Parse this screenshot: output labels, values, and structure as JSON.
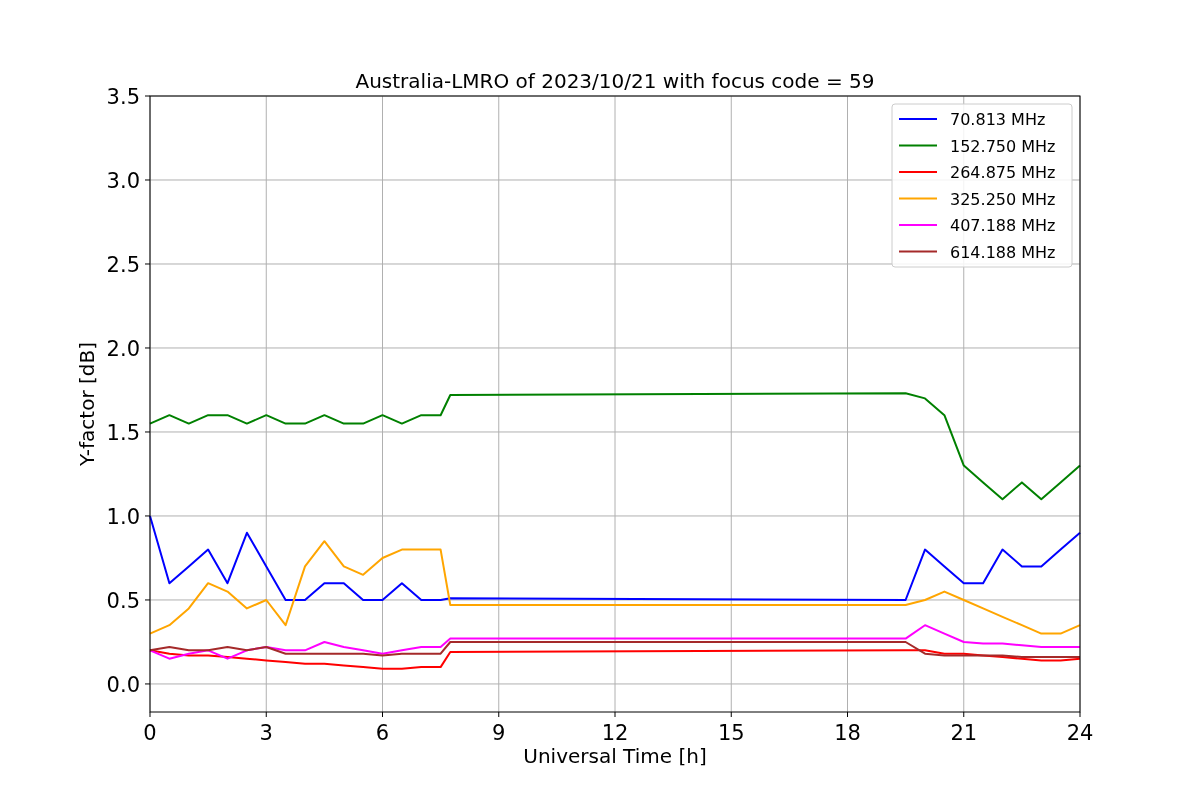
{
  "chart_data": {
    "type": "line",
    "title": "Australia-LMRO of 2023/10/21 with focus code = 59",
    "xlabel": "Universal Time [h]",
    "ylabel": "Y-factor [dB]",
    "x": [
      0,
      0.5,
      1,
      1.5,
      2,
      2.5,
      3,
      3.5,
      4,
      4.5,
      5,
      5.5,
      6,
      6.5,
      7,
      7.5,
      7.75,
      19.5,
      20,
      20.5,
      21,
      21.5,
      22,
      22.5,
      23,
      23.5,
      24
    ],
    "series": [
      {
        "name": "70.813 MHz",
        "color": "#0000ff",
        "values": [
          1.0,
          0.6,
          0.7,
          0.8,
          0.6,
          0.9,
          0.7,
          0.5,
          0.5,
          0.6,
          0.6,
          0.5,
          0.5,
          0.6,
          0.5,
          0.5,
          0.51,
          0.5,
          0.8,
          0.7,
          0.6,
          0.6,
          0.8,
          0.7,
          0.7,
          0.8,
          0.9
        ]
      },
      {
        "name": "152.750 MHz",
        "color": "#008000",
        "values": [
          1.55,
          1.6,
          1.55,
          1.6,
          1.6,
          1.55,
          1.6,
          1.55,
          1.55,
          1.6,
          1.55,
          1.55,
          1.6,
          1.55,
          1.6,
          1.6,
          1.72,
          1.73,
          1.7,
          1.6,
          1.3,
          1.2,
          1.1,
          1.2,
          1.1,
          1.2,
          1.3
        ]
      },
      {
        "name": "264.875 MHz",
        "color": "#ff0000",
        "values": [
          0.2,
          0.18,
          0.17,
          0.17,
          0.16,
          0.15,
          0.14,
          0.13,
          0.12,
          0.12,
          0.11,
          0.1,
          0.09,
          0.09,
          0.1,
          0.1,
          0.19,
          0.2,
          0.2,
          0.18,
          0.18,
          0.17,
          0.16,
          0.15,
          0.14,
          0.14,
          0.15
        ]
      },
      {
        "name": "325.250 MHz",
        "color": "#ffa500",
        "values": [
          0.3,
          0.35,
          0.45,
          0.6,
          0.55,
          0.45,
          0.5,
          0.35,
          0.7,
          0.85,
          0.7,
          0.65,
          0.75,
          0.8,
          0.8,
          0.8,
          0.47,
          0.47,
          0.5,
          0.55,
          0.5,
          0.45,
          0.4,
          0.35,
          0.3,
          0.3,
          0.35
        ]
      },
      {
        "name": "407.188 MHz",
        "color": "#ff00ff",
        "values": [
          0.2,
          0.15,
          0.18,
          0.2,
          0.15,
          0.2,
          0.22,
          0.2,
          0.2,
          0.25,
          0.22,
          0.2,
          0.18,
          0.2,
          0.22,
          0.22,
          0.27,
          0.27,
          0.35,
          0.3,
          0.25,
          0.24,
          0.24,
          0.23,
          0.22,
          0.22,
          0.22
        ]
      },
      {
        "name": "614.188 MHz",
        "color": "#a52a2a",
        "values": [
          0.2,
          0.22,
          0.2,
          0.2,
          0.22,
          0.2,
          0.22,
          0.18,
          0.18,
          0.18,
          0.18,
          0.18,
          0.17,
          0.18,
          0.18,
          0.18,
          0.25,
          0.25,
          0.18,
          0.17,
          0.17,
          0.17,
          0.17,
          0.16,
          0.16,
          0.16,
          0.16
        ]
      }
    ],
    "grid": true,
    "legend": true,
    "xlim": [
      0,
      24
    ],
    "ylim": [
      -0.167,
      3.5
    ],
    "xticks": [
      0,
      3,
      6,
      9,
      12,
      15,
      18,
      21,
      24
    ],
    "yticks": [
      {
        "value": 0,
        "label": "0.0"
      },
      {
        "value": 0.5,
        "label": "0.5"
      },
      {
        "value": 1,
        "label": "1.0"
      },
      {
        "value": 1.5,
        "label": "1.5"
      },
      {
        "value": 2,
        "label": "2.0"
      },
      {
        "value": 2.5,
        "label": "2.5"
      },
      {
        "value": 3,
        "label": "3.0"
      },
      {
        "value": 3.5,
        "label": "3.5"
      }
    ]
  }
}
